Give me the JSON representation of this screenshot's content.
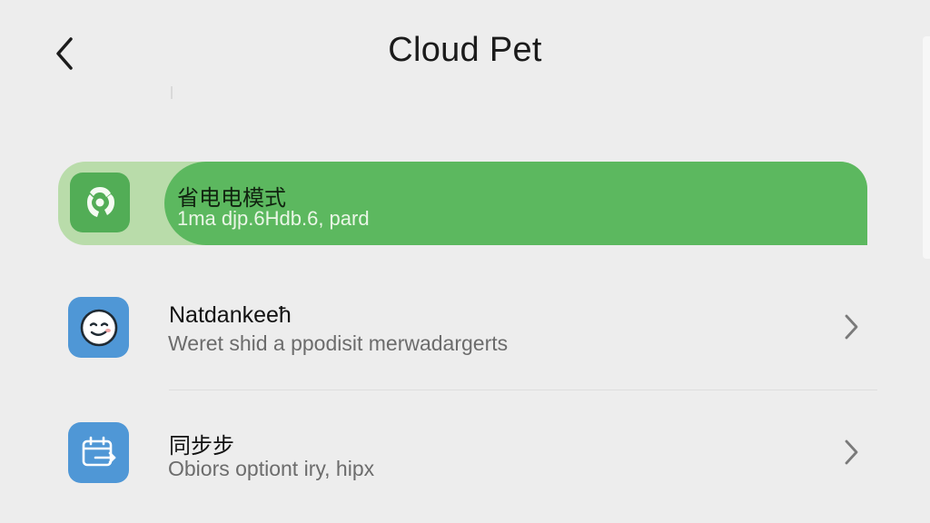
{
  "header": {
    "title": "Cloud Pet",
    "back_icon": "chevron-left-icon"
  },
  "settings": [
    {
      "title": "省电电模式",
      "subtitle": "1ma djp.6Hdb.6, pard",
      "icon": "recycle-icon",
      "highlighted": true,
      "color": "#5cb85f"
    },
    {
      "title": "Natdankeeħ",
      "subtitle": "Weret shid a ppodisit merwadargerts",
      "icon": "pet-face-icon",
      "color": "#4f97d6"
    },
    {
      "title": "同步步",
      "subtitle": "Obiors optiont iry, hipx",
      "icon": "sync-calendar-icon",
      "color": "#4f97d6"
    }
  ],
  "colors": {
    "background": "#ededed",
    "accent_green": "#5cb85f",
    "accent_blue": "#4f97d6"
  }
}
